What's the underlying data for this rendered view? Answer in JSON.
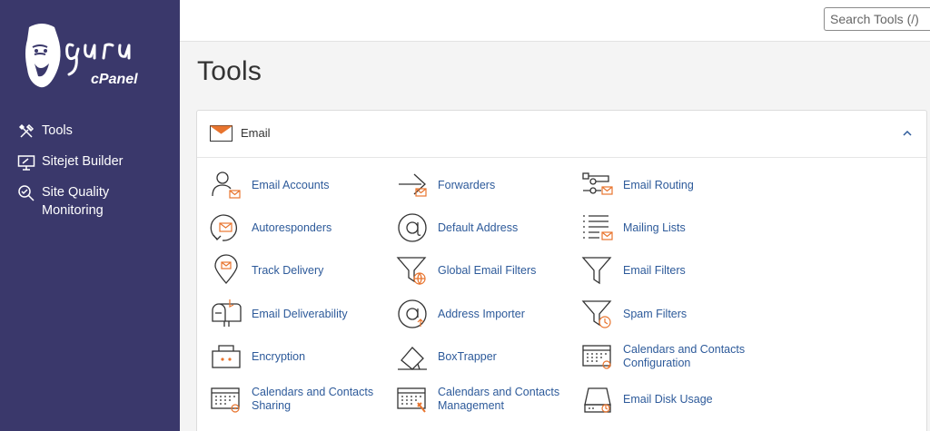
{
  "brand": {
    "name": "Guru cPanel",
    "logo_text_top": "guru",
    "logo_text_bottom": "cPanel"
  },
  "sidebar": {
    "items": [
      {
        "label": "Tools",
        "icon": "tools-icon"
      },
      {
        "label": "Sitejet Builder",
        "icon": "monitor-icon"
      },
      {
        "label": "Site Quality Monitoring",
        "icon": "magnifier-icon"
      }
    ]
  },
  "header": {
    "search_placeholder": "Search Tools (/)"
  },
  "page": {
    "title": "Tools"
  },
  "email_section": {
    "title": "Email",
    "icon": "envelope-icon",
    "collapse_icon": "chevron-up-icon",
    "tools": [
      {
        "label": "Email Accounts",
        "icon": "email-accounts-icon"
      },
      {
        "label": "Forwarders",
        "icon": "forwarders-icon"
      },
      {
        "label": "Email Routing",
        "icon": "email-routing-icon"
      },
      {
        "label": "Autoresponders",
        "icon": "autoresponders-icon"
      },
      {
        "label": "Default Address",
        "icon": "at-sign-icon"
      },
      {
        "label": "Mailing Lists",
        "icon": "mailing-lists-icon"
      },
      {
        "label": "Track Delivery",
        "icon": "location-pin-icon"
      },
      {
        "label": "Global Email Filters",
        "icon": "global-filter-icon"
      },
      {
        "label": "Email Filters",
        "icon": "filter-icon"
      },
      {
        "label": "Email Deliverability",
        "icon": "mailbox-icon"
      },
      {
        "label": "Address Importer",
        "icon": "address-importer-icon"
      },
      {
        "label": "Spam Filters",
        "icon": "spam-filter-icon"
      },
      {
        "label": "Encryption",
        "icon": "encryption-icon"
      },
      {
        "label": "BoxTrapper",
        "icon": "boxtrapper-icon"
      },
      {
        "label": "Calendars and Contacts Configuration",
        "icon": "calendar-config-icon"
      },
      {
        "label": "Calendars and Contacts Sharing",
        "icon": "calendar-sharing-icon"
      },
      {
        "label": "Calendars and Contacts Management",
        "icon": "calendar-management-icon"
      },
      {
        "label": "Email Disk Usage",
        "icon": "disk-usage-icon"
      }
    ]
  },
  "colors": {
    "sidebar_bg": "#3a386b",
    "link": "#2d5a9a",
    "accent": "#e8742e"
  }
}
